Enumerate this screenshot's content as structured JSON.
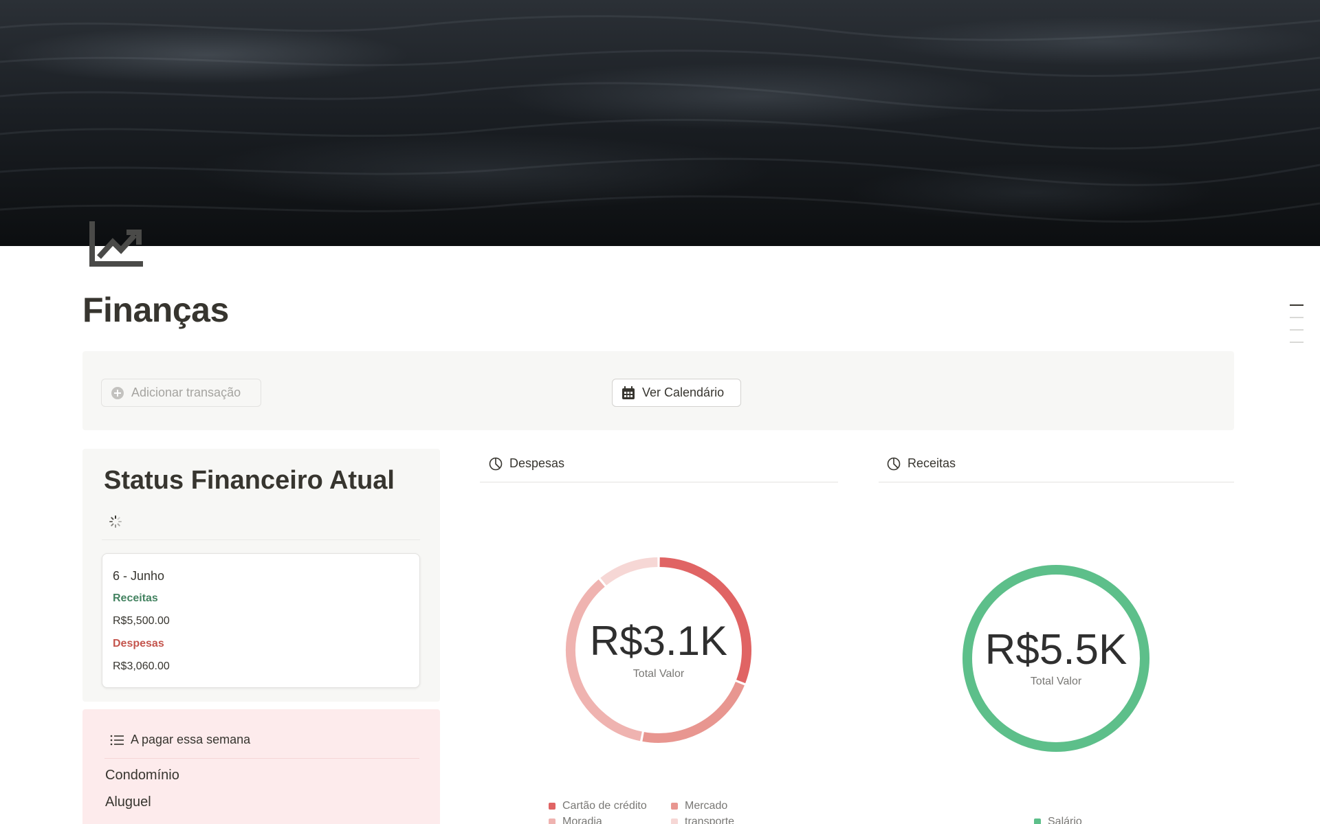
{
  "page": {
    "title": "Finanças",
    "icon": "trending-up-chart-icon"
  },
  "actions": {
    "add_transaction": "Adicionar transação",
    "view_calendar": "Ver Calendário"
  },
  "status": {
    "title": "Status Financeiro Atual",
    "card": {
      "month": "6 - Junho",
      "income_label": "Receitas",
      "income_value": "R$5,500.00",
      "expense_label": "Despesas",
      "expense_value": "R$3,060.00"
    }
  },
  "pay_week": {
    "title": "A pagar essa semana",
    "items": [
      "Condomínio",
      "Aluguel"
    ]
  },
  "colors": {
    "income": "#448361",
    "expense": "#c4554d",
    "pay_bg": "#fdebec",
    "income_ring": "#5dbf8a"
  },
  "chart_data": [
    {
      "type": "pie",
      "title": "Despesas",
      "center_value": "R$3.1K",
      "center_label": "Total Valor",
      "categories": [
        "Cartão de crédito",
        "Mercado",
        "Moradia",
        "transporte"
      ],
      "values": [
        0.31,
        0.22,
        0.36,
        0.11
      ],
      "colors": [
        "#e06464",
        "#e89690",
        "#efb3b0",
        "#f6d7d5"
      ]
    },
    {
      "type": "pie",
      "title": "Receitas",
      "center_value": "R$5.5K",
      "center_label": "Total Valor",
      "categories": [
        "Salário"
      ],
      "values": [
        1.0
      ],
      "colors": [
        "#5dbf8a"
      ]
    }
  ]
}
